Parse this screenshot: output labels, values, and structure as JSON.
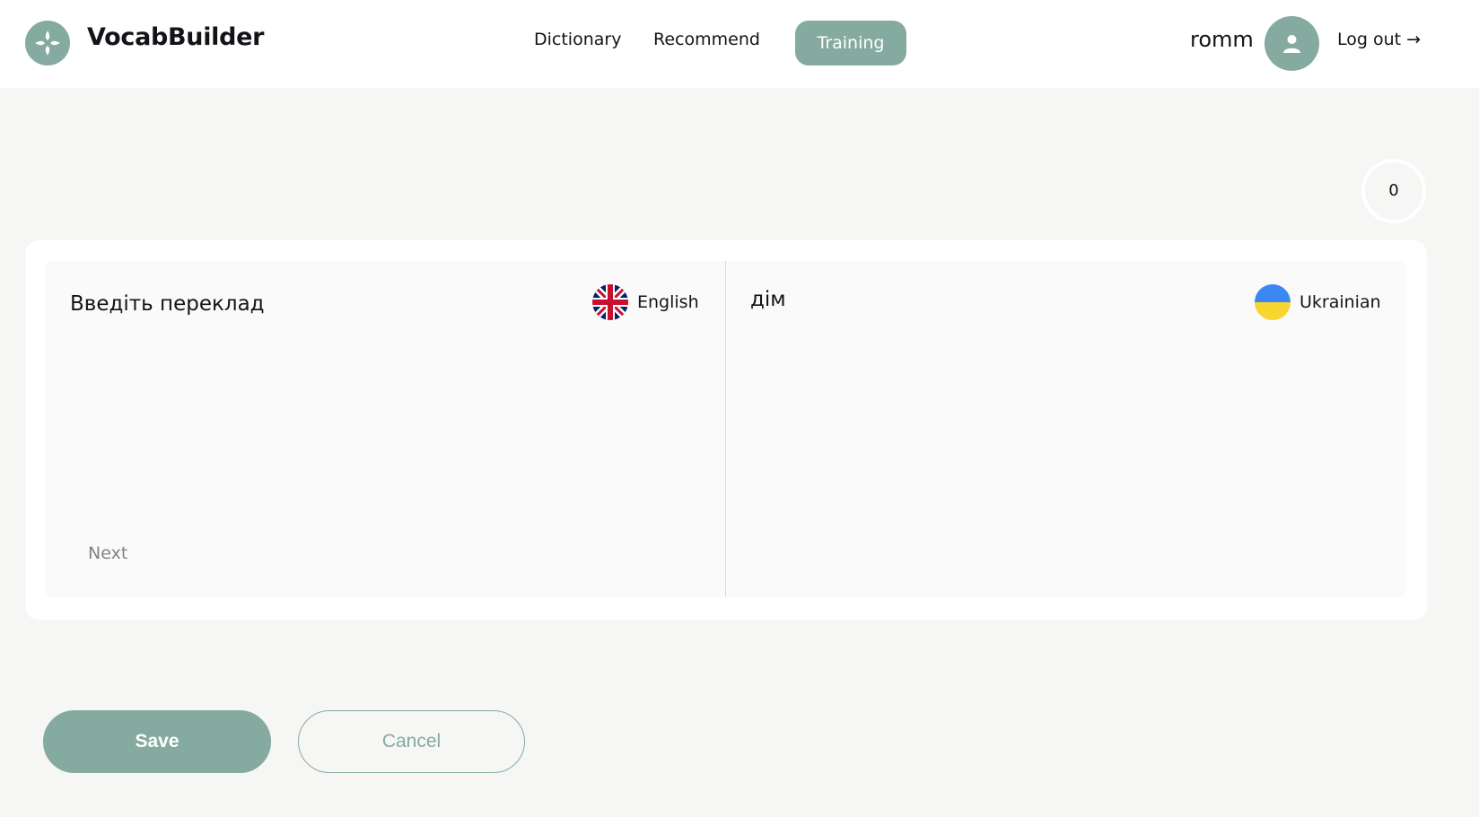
{
  "app": {
    "brand": "VocabBuilder"
  },
  "nav": {
    "dictionary": "Dictionary",
    "recommend": "Recommend",
    "training": "Training"
  },
  "user": {
    "name": "romm",
    "logout": "Log out →"
  },
  "progress": {
    "count": "0"
  },
  "training": {
    "input_placeholder": "Введіть переклад",
    "input_value": "",
    "source_language": "English",
    "target_language": "Ukrainian",
    "word": "дім",
    "next_label": "Next"
  },
  "actions": {
    "save": "Save",
    "cancel": "Cancel"
  },
  "colors": {
    "accent": "#85aa9f",
    "background": "#f6f6f5",
    "text": "#121417"
  },
  "icons": {
    "logo": "logo-icon",
    "avatar": "user-icon",
    "english_flag": "uk-flag-icon",
    "ukrainian_flag": "ukraine-flag-icon"
  }
}
